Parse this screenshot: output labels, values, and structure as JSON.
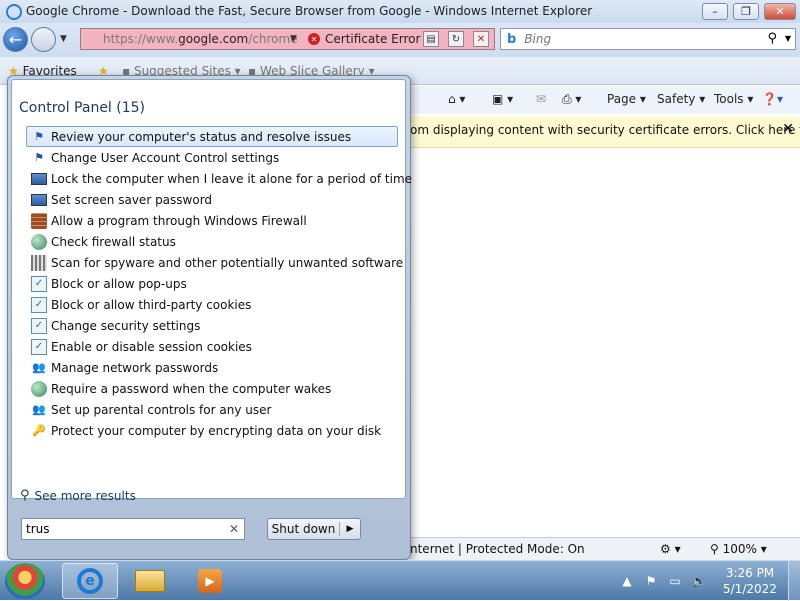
{
  "window": {
    "title": "Google Chrome - Download the Fast, Secure Browser from Google - Windows Internet Explorer",
    "minimize": "–",
    "maximize": "❐",
    "close": "✕"
  },
  "address": {
    "url_prefix": "https://www.",
    "url_domain": "google.com",
    "url_path": "/chrome",
    "cert_label": "Certificate Error"
  },
  "search_engine": {
    "logo": "b",
    "placeholder": "Bing"
  },
  "favorites_bar": {
    "favorites": "Favorites",
    "suggested_sites": "Suggested Sites ▾",
    "web_slice": "Web Slice Gallery ▾"
  },
  "command_bar": {
    "page": "Page ▾",
    "safety": "Safety ▾",
    "tools": "Tools ▾"
  },
  "info_bar": {
    "text": "om displaying content with security certificate errors. Click here for"
  },
  "status_bar": {
    "zone": "nternet | Protected Mode: On",
    "zoom": "100%"
  },
  "start_menu": {
    "heading": "Control Panel (15)",
    "items": [
      {
        "label": "Review your computer's status and resolve issues",
        "icon": "flag"
      },
      {
        "label": "Change User Account Control settings",
        "icon": "flag"
      },
      {
        "label": "Lock the computer when I leave it alone for a period of time",
        "icon": "monitor"
      },
      {
        "label": "Set screen saver password",
        "icon": "monitor"
      },
      {
        "label": "Allow a program through Windows Firewall",
        "icon": "firewall"
      },
      {
        "label": "Check firewall status",
        "icon": "firewall-globe"
      },
      {
        "label": "Scan for spyware and other potentially unwanted software",
        "icon": "scan"
      },
      {
        "label": "Block or allow pop-ups",
        "icon": "internet-options"
      },
      {
        "label": "Block or allow third-party cookies",
        "icon": "internet-options"
      },
      {
        "label": "Change security settings",
        "icon": "internet-options"
      },
      {
        "label": "Enable or disable session cookies",
        "icon": "internet-options"
      },
      {
        "label": "Manage network passwords",
        "icon": "users"
      },
      {
        "label": "Require a password when the computer wakes",
        "icon": "power-globe"
      },
      {
        "label": "Set up parental controls for any user",
        "icon": "users"
      },
      {
        "label": "Protect your computer by encrypting data on your disk",
        "icon": "key"
      }
    ],
    "see_more": "See more results",
    "search_value": "trus",
    "shutdown_label": "Shut down"
  },
  "taskbar": {
    "time": "3:26 PM",
    "date": "5/1/2022"
  }
}
